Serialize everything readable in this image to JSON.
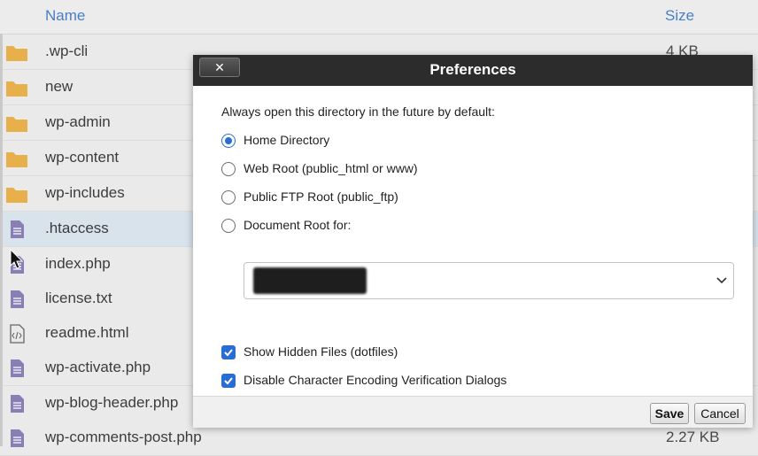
{
  "file_list": {
    "columns": {
      "name": "Name",
      "size": "Size"
    },
    "rows": [
      {
        "name": ".wp-cli",
        "size": "4 KB",
        "type": "folder"
      },
      {
        "name": "new",
        "size": "",
        "type": "folder"
      },
      {
        "name": "wp-admin",
        "size": "",
        "type": "folder"
      },
      {
        "name": "wp-content",
        "size": "",
        "type": "folder"
      },
      {
        "name": "wp-includes",
        "size": "",
        "type": "folder"
      },
      {
        "name": ".htaccess",
        "size": "",
        "type": "file",
        "selected": true
      },
      {
        "name": "index.php",
        "size": "",
        "type": "file"
      },
      {
        "name": "license.txt",
        "size": "",
        "type": "file"
      },
      {
        "name": "readme.html",
        "size": "",
        "type": "code"
      },
      {
        "name": "wp-activate.php",
        "size": "",
        "type": "file"
      },
      {
        "name": "wp-blog-header.php",
        "size": "",
        "type": "file"
      },
      {
        "name": "wp-comments-post.php",
        "size": "2.27 KB",
        "type": "file"
      }
    ]
  },
  "dialog": {
    "title": "Preferences",
    "close_label": "✕",
    "intro": "Always open this directory in the future by default:",
    "options": [
      {
        "label": "Home Directory",
        "checked": true
      },
      {
        "label": "Web Root (public_html or www)",
        "checked": false
      },
      {
        "label": "Public FTP Root (public_ftp)",
        "checked": false
      },
      {
        "label": "Document Root for:",
        "checked": false
      }
    ],
    "checkboxes": [
      {
        "label": "Show Hidden Files (dotfiles)",
        "checked": true
      },
      {
        "label": "Disable Character Encoding Verification Dialogs",
        "checked": true
      }
    ],
    "save_label": "Save",
    "cancel_label": "Cancel"
  },
  "colors": {
    "accent": "#2a6cd6",
    "titlebar": "#2c2c2c",
    "header_text": "#4a7fc6",
    "folder": "#e8b04a",
    "file_icon": "#8a7fb5"
  }
}
